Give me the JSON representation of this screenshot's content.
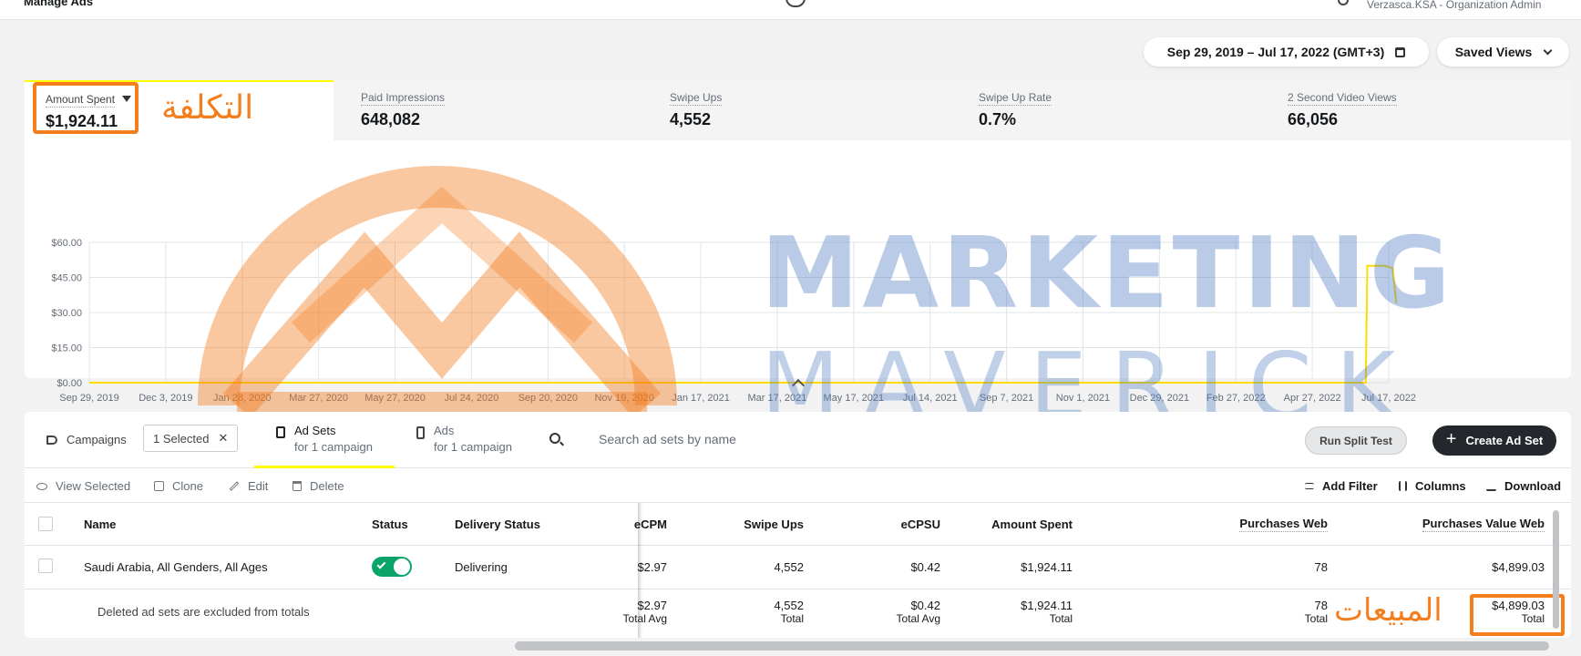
{
  "topbar": {
    "app_title": "Manage Ads",
    "org": "Verzasca.KSA - Organization Admin"
  },
  "date_range": {
    "label": "Sep 29, 2019 – Jul 17, 2022 (GMT+3)"
  },
  "saved_views": {
    "label": "Saved Views"
  },
  "metrics": [
    {
      "label": "Amount Spent",
      "value": "$1,924.11"
    },
    {
      "label": "Paid Impressions",
      "value": "648,082"
    },
    {
      "label": "Swipe Ups",
      "value": "4,552"
    },
    {
      "label": "Swipe Up Rate",
      "value": "0.7%"
    },
    {
      "label": "2 Second Video Views",
      "value": "66,056"
    }
  ],
  "annotations": {
    "cost": "التكلفة",
    "sales": "المبيعات"
  },
  "chart_data": {
    "type": "line",
    "x": [
      "Sep 29, 2019",
      "Dec 3, 2019",
      "Jan 28, 2020",
      "Mar 27, 2020",
      "May 27, 2020",
      "Jul 24, 2020",
      "Sep 20, 2020",
      "Nov 19, 2020",
      "Jan 17, 2021",
      "Mar 17, 2021",
      "May 17, 2021",
      "Jul 14, 2021",
      "Sep 7, 2021",
      "Nov 1, 2021",
      "Dec 29, 2021",
      "Feb 27, 2022",
      "Apr 27, 2022",
      "Jul 17, 2022"
    ],
    "y_ticks": [
      "$0.00",
      "$15.00",
      "$30.00",
      "$45.00",
      "$60.00"
    ],
    "ylim": [
      0,
      60
    ],
    "series": [
      {
        "color": "#ffdb00",
        "points": [
          [
            0,
            0
          ],
          [
            16.7,
            0
          ],
          [
            16.72,
            50
          ],
          [
            16.95,
            50
          ],
          [
            17.05,
            49
          ],
          [
            17.1,
            34
          ]
        ]
      }
    ],
    "grid": true
  },
  "tabs": {
    "campaigns": "Campaigns",
    "selected_chip": "1 Selected",
    "adsets": {
      "title": "Ad Sets",
      "sub": "for 1 campaign"
    },
    "ads": {
      "title": "Ads",
      "sub": "for 1 campaign"
    }
  },
  "search": {
    "placeholder": "Search ad sets by name"
  },
  "buttons": {
    "split_test": "Run Split Test",
    "create": "Create Ad Set"
  },
  "toolbar": {
    "view_selected": "View Selected",
    "clone": "Clone",
    "edit": "Edit",
    "delete": "Delete",
    "add_filter": "Add Filter",
    "columns": "Columns",
    "download": "Download"
  },
  "table": {
    "headers": {
      "name": "Name",
      "status": "Status",
      "delivery": "Delivery Status",
      "ecpm": "eCPM",
      "swipe_ups": "Swipe Ups",
      "ecpsu": "eCPSU",
      "amount_spent": "Amount Spent",
      "purchases_web": "Purchases Web",
      "purchases_value_web": "Purchases Value Web"
    },
    "row": {
      "name": "Saudi Arabia, All Genders, All Ages",
      "delivery": "Delivering",
      "ecpm": "$2.97",
      "swipe_ups": "4,552",
      "ecpsu": "$0.42",
      "amount_spent": "$1,924.11",
      "purchases_web": "78",
      "purchases_value_web": "$4,899.03"
    },
    "totals": {
      "note": "Deleted ad sets are excluded from totals",
      "ecpm": "$2.97",
      "ecpm_sub": "Total Avg",
      "swipe_ups": "4,552",
      "swipe_ups_sub": "Total",
      "ecpsu": "$0.42",
      "ecpsu_sub": "Total Avg",
      "amount_spent": "$1,924.11",
      "amount_spent_sub": "Total",
      "purchases_web": "78",
      "purchases_web_sub": "Total",
      "purchases_value_web": "$4,899.03",
      "purchases_value_web_sub": "Total"
    }
  },
  "watermark": {
    "line1": "MARKETING",
    "line2": "MAVERICK"
  }
}
